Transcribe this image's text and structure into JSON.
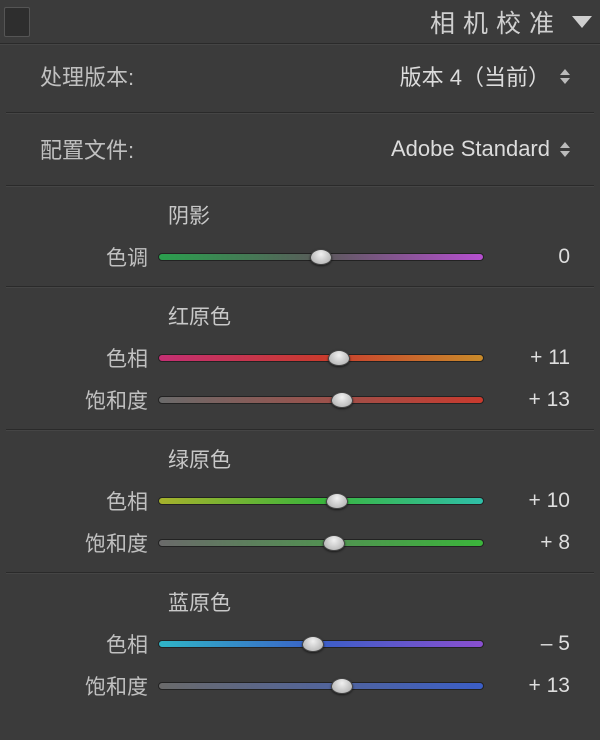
{
  "panel": {
    "title": "相机校准"
  },
  "process": {
    "label": "处理版本:",
    "value": "版本 4（当前）"
  },
  "profile": {
    "label": "配置文件:",
    "value": "Adobe Standard"
  },
  "shadows": {
    "title": "阴影",
    "tint_label": "色调",
    "tint_value": "0",
    "tint_pos": "50%"
  },
  "red": {
    "title": "红原色",
    "hue_label": "色相",
    "hue_value": "+ 11",
    "hue_pos": "55.5%",
    "sat_label": "饱和度",
    "sat_value": "+ 13",
    "sat_pos": "56.5%"
  },
  "green": {
    "title": "绿原色",
    "hue_label": "色相",
    "hue_value": "+ 10",
    "hue_pos": "55%",
    "sat_label": "饱和度",
    "sat_value": "+ 8",
    "sat_pos": "54%"
  },
  "blue": {
    "title": "蓝原色",
    "hue_label": "色相",
    "hue_value": "– 5",
    "hue_pos": "47.5%",
    "sat_label": "饱和度",
    "sat_value": "+ 13",
    "sat_pos": "56.5%"
  }
}
